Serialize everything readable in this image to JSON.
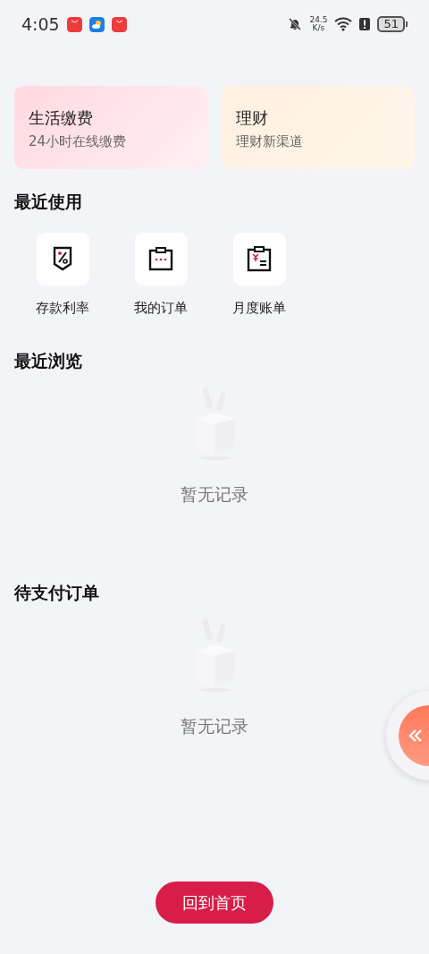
{
  "status_bar": {
    "time": "4:05",
    "net_speed": "24.5",
    "net_unit": "K/s",
    "battery": "51"
  },
  "service_cards": [
    {
      "kind": "bill",
      "title": "生活缴费",
      "subtitle": "24小时在线缴费"
    },
    {
      "kind": "finance",
      "title": "理财",
      "subtitle": "理财新渠道"
    }
  ],
  "recent_use": {
    "title": "最近使用",
    "items": [
      {
        "kind": "rate",
        "label": "存款利率"
      },
      {
        "kind": "order",
        "label": "我的订单"
      },
      {
        "kind": "bill",
        "label": "月度账单"
      }
    ]
  },
  "sections": [
    {
      "title": "最近浏览",
      "empty_text": "暂无记录"
    },
    {
      "title": "待支付订单",
      "empty_text": "暂无记录"
    }
  ],
  "home_button": "回到首页"
}
